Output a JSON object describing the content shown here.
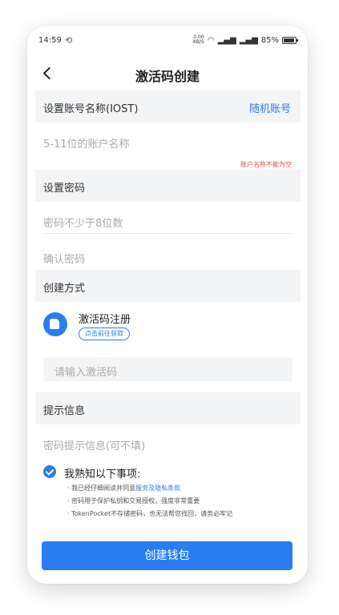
{
  "status_bar": {
    "time": "14:59",
    "speed_top": "0.00",
    "speed_unit": "KB/S",
    "battery_percent": "85%"
  },
  "header": {
    "title": "激活码创建"
  },
  "account": {
    "label": "设置账号名称(IOST)",
    "random_link": "随机账号",
    "placeholder": "5-11位的账户名称",
    "error": "账户名称不能为空"
  },
  "password": {
    "label": "设置密码",
    "placeholder": "密码不少于8位数",
    "confirm_placeholder": "确认密码"
  },
  "method": {
    "label": "创建方式",
    "option_title": "激活码注册",
    "option_link": "点击前往获取",
    "code_placeholder": "请输入激活码"
  },
  "hint": {
    "label": "提示信息",
    "placeholder": "密码提示信息(可不填)"
  },
  "agreement": {
    "title": "我熟知以下事项:",
    "line1_prefix": "· 我已经仔细阅读并同意",
    "line1_link": "服务及隐私条款",
    "line2": "· 密码用于保护私钥和交易授权，强度非常重要",
    "line3": "· TokenPocket不存储密码，也无法帮您找回，请务必牢记"
  },
  "actions": {
    "create_label": "创建钱包"
  },
  "colors": {
    "accent": "#2b7cf0",
    "error": "#e5484d",
    "section_bg": "#f3f4f6"
  }
}
